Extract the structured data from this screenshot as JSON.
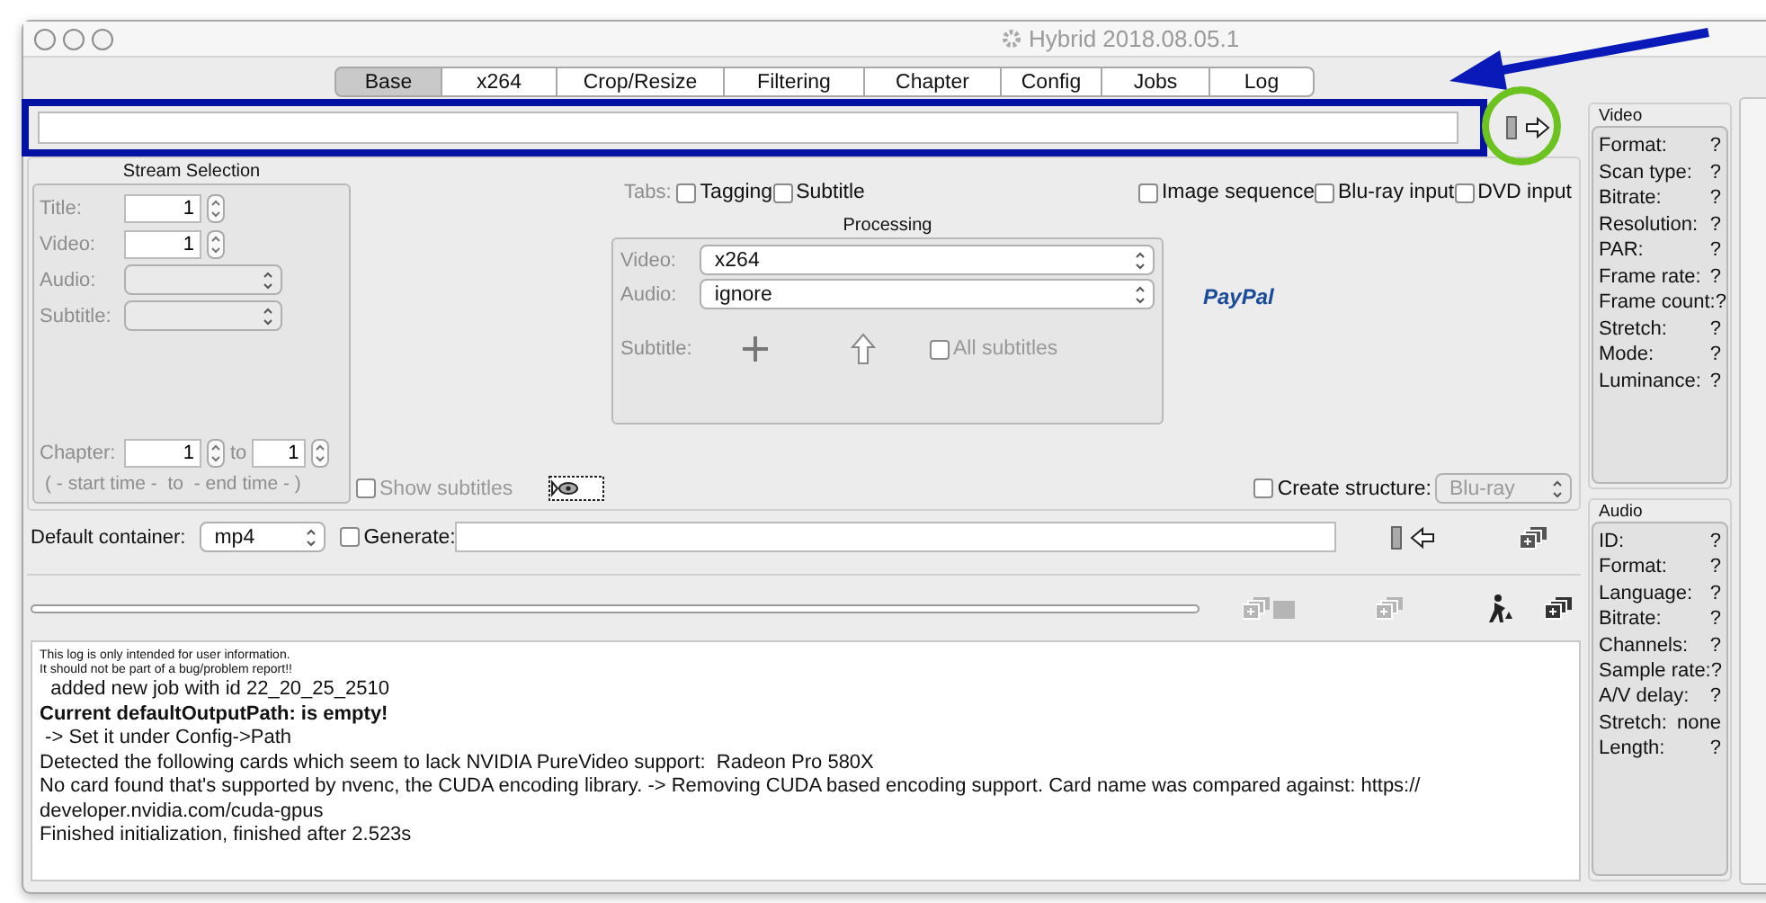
{
  "window": {
    "title": "Hybrid 2018.08.05.1"
  },
  "tabs": [
    {
      "label": "Base",
      "selected": true
    },
    {
      "label": "x264",
      "selected": false
    },
    {
      "label": "Crop/Resize",
      "selected": false
    },
    {
      "label": "Filtering",
      "selected": false
    },
    {
      "label": "Chapter",
      "selected": false
    },
    {
      "label": "Config",
      "selected": false
    },
    {
      "label": "Jobs",
      "selected": false
    },
    {
      "label": "Log",
      "selected": false
    }
  ],
  "stream_selection": {
    "title": "Stream Selection",
    "fields": [
      {
        "label": "Title:",
        "kind": "spin",
        "value": "1",
        "disabled": true
      },
      {
        "label": "Video:",
        "kind": "spin",
        "value": "1",
        "disabled": true
      },
      {
        "label": "Audio:",
        "kind": "combo",
        "disabled": true
      },
      {
        "label": "Subtitle:",
        "kind": "combo",
        "disabled": true
      }
    ],
    "chapter": {
      "label": "Chapter:",
      "from": "1",
      "to_label": "to",
      "to": "1",
      "hint": "( - start time -  to  - end time - )"
    }
  },
  "tab_options": {
    "label": "Tabs:",
    "checkboxes": [
      {
        "label": "Tagging",
        "checked": false
      },
      {
        "label": "Subtitle",
        "checked": false
      }
    ]
  },
  "input_options": [
    {
      "label": "Image sequence",
      "checked": false
    },
    {
      "label": "Blu-ray input",
      "checked": false
    },
    {
      "label": "DVD input",
      "checked": false
    }
  ],
  "processing": {
    "title": "Processing",
    "video_label": "Video:",
    "video": "x264",
    "audio_label": "Audio:",
    "audio": "ignore",
    "subtitle_label": "Subtitle:",
    "all_subtitles": {
      "label": "All subtitles",
      "checked": false,
      "disabled": true
    }
  },
  "paypal": "PayPal",
  "show_subtitles": {
    "label": "Show subtitles",
    "checked": false,
    "disabled": true
  },
  "create_structure": {
    "label": "Create structure:",
    "checked": false,
    "value": "Blu-ray",
    "disabled": true
  },
  "default_container": {
    "label": "Default container:",
    "value": "mp4"
  },
  "generate": {
    "label": "Generate:",
    "checked": false
  },
  "progress": {
    "level": 0
  },
  "log": [
    {
      "kind": "small",
      "text": "This log is only intended for user information."
    },
    {
      "kind": "small",
      "text": "It should not be part of a bug/problem report!!"
    },
    {
      "kind": "normal",
      "text": "  added new job with id 22_20_25_2510"
    },
    {
      "kind": "bold",
      "text": "Current defaultOutputPath: is empty!"
    },
    {
      "kind": "normal",
      "text": " -> Set it under Config->Path"
    },
    {
      "kind": "normal",
      "text": "Detected the following cards which seem to lack NVIDIA PureVideo support:  Radeon Pro 580X"
    },
    {
      "kind": "normal",
      "text": "No card found that's supported by nvenc, the CUDA encoding library. -> Removing CUDA based encoding support. Card name was compared against: https://"
    },
    {
      "kind": "normal",
      "text": "developer.nvidia.com/cuda-gpus"
    },
    {
      "kind": "normal",
      "text": "Finished initialization, finished after 2.523s"
    }
  ],
  "video_info": {
    "title": "Video",
    "rows": [
      {
        "label": "Format:",
        "value": "?"
      },
      {
        "label": "Scan type:",
        "value": "?"
      },
      {
        "label": "Bitrate:",
        "value": "?"
      },
      {
        "label": "Resolution:",
        "value": "?"
      },
      {
        "label": "PAR:",
        "value": "?"
      },
      {
        "label": "Frame rate:",
        "value": "?"
      },
      {
        "label": "Frame count:",
        "value": "?"
      },
      {
        "label": "Stretch:",
        "value": "?"
      },
      {
        "label": "Mode:",
        "value": "?"
      },
      {
        "label": "Luminance:",
        "value": "?"
      }
    ]
  },
  "audio_info": {
    "title": "Audio",
    "rows": [
      {
        "label": "ID:",
        "value": "?"
      },
      {
        "label": "Format:",
        "value": "?"
      },
      {
        "label": "Language:",
        "value": "?"
      },
      {
        "label": "Bitrate:",
        "value": "?"
      },
      {
        "label": "Channels:",
        "value": "?"
      },
      {
        "label": "Sample rate:",
        "value": "?"
      },
      {
        "label": "A/V delay:",
        "value": "?"
      },
      {
        "label": "Stretch:",
        "value": "none"
      },
      {
        "label": "Length:",
        "value": "?"
      }
    ]
  }
}
